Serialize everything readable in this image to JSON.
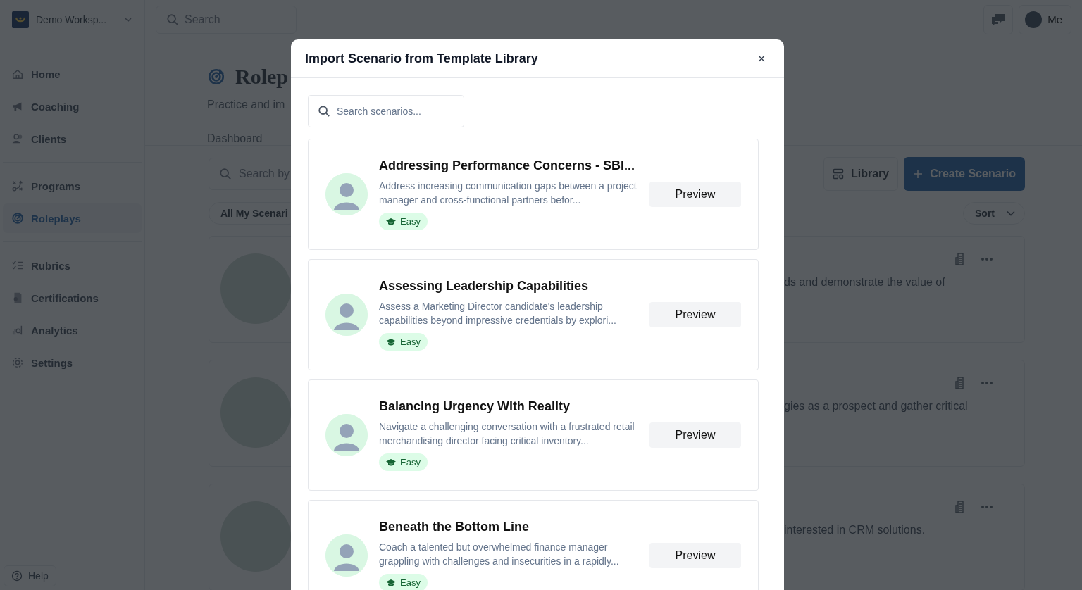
{
  "workspace": {
    "name": "Demo Worksp..."
  },
  "top_search": {
    "placeholder": "Search"
  },
  "user_menu": {
    "label": "Me"
  },
  "sidebar": {
    "groups": [
      [
        {
          "label": "Home",
          "selected": false
        },
        {
          "label": "Coaching",
          "selected": false
        },
        {
          "label": "Clients",
          "selected": false
        }
      ],
      [
        {
          "label": "Programs",
          "selected": false
        },
        {
          "label": "Roleplays",
          "selected": true
        }
      ],
      [
        {
          "label": "Rubrics",
          "selected": false
        },
        {
          "label": "Certifications",
          "selected": false
        },
        {
          "label": "Analytics",
          "selected": false
        },
        {
          "label": "Settings",
          "selected": false
        }
      ]
    ],
    "help": "Help"
  },
  "page": {
    "title": "Rolep",
    "subtitle": "Practice and im",
    "tabs": [
      "Dashboard"
    ],
    "search": {
      "placeholder": "Search by"
    },
    "filter_chip": "All My Scenari",
    "library_button": "Library",
    "create_button": "Create Scenario",
    "sort_button": "Sort",
    "scenarios": [
      {
        "description": "ds and demonstrate the value of"
      },
      {
        "description": "gies as a prospect and gather critical"
      },
      {
        "description": "interested in CRM solutions."
      }
    ]
  },
  "modal": {
    "title": "Import Scenario from Template Library",
    "close": "×",
    "search": {
      "placeholder": "Search scenarios..."
    },
    "templates": [
      {
        "title": "Addressing Performance Concerns - SBI...",
        "description": "Address increasing communication gaps between a project manager and cross-functional partners befor...",
        "difficulty": "Easy",
        "action": "Preview"
      },
      {
        "title": "Assessing Leadership Capabilities",
        "description": "Assess a Marketing Director candidate's leadership capabilities beyond impressive credentials by explori...",
        "difficulty": "Easy",
        "action": "Preview"
      },
      {
        "title": "Balancing Urgency With Reality",
        "description": "Navigate a challenging conversation with a frustrated retail merchandising director facing critical inventory...",
        "difficulty": "Easy",
        "action": "Preview"
      },
      {
        "title": "Beneath the Bottom Line",
        "description": "Coach a talented but overwhelmed finance manager grappling with challenges and insecurities in a rapidly...",
        "difficulty": "Easy",
        "action": "Preview"
      }
    ]
  }
}
